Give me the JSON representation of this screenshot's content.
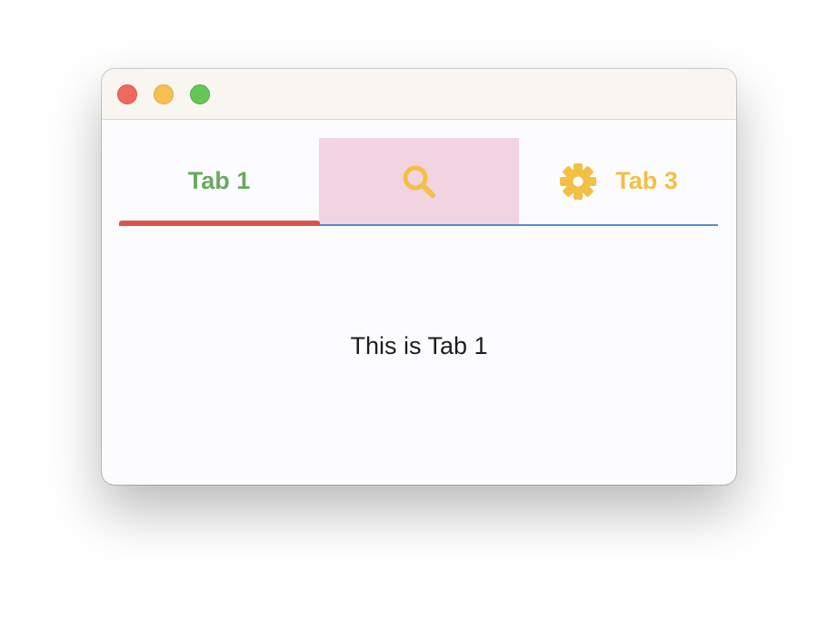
{
  "window": {
    "controls": [
      "close",
      "minimize",
      "maximize"
    ]
  },
  "tabs": [
    {
      "label": "Tab 1",
      "icon": null,
      "selected": true,
      "color": "#6aa95f"
    },
    {
      "label": "",
      "icon": "search-icon",
      "selected": false,
      "color": "#f2c043",
      "background": "#f2d3e0"
    },
    {
      "label": "Tab 3",
      "icon": "gear-icon",
      "selected": false,
      "color": "#f2c043"
    }
  ],
  "indicator_color": "#dc5447",
  "baseline_color": "#4d8fd0",
  "content": {
    "text": "This is Tab 1"
  }
}
